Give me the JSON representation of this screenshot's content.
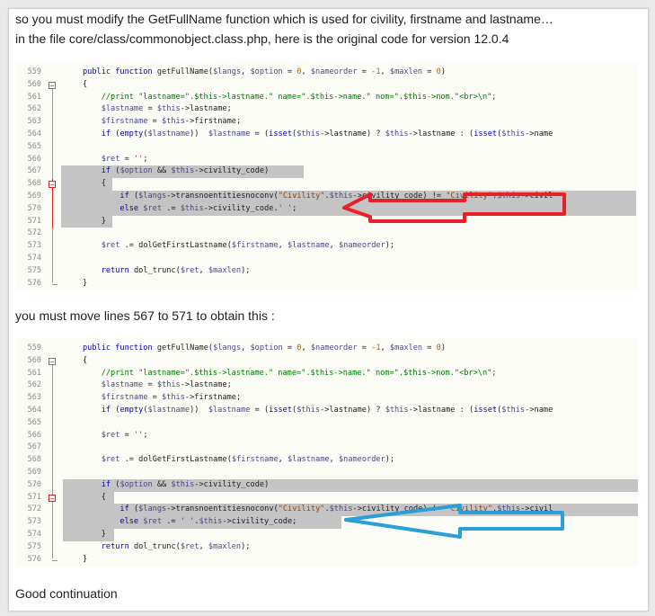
{
  "intro": {
    "line1": "so you must modify the GetFullName function which is used for civility, firstname and lastname…",
    "line2": "in the file core/class/commonobject.class.php, here is the original code for version 12.0.4"
  },
  "middle_text": "you must move lines 567 to 571 to obtain this :",
  "closing_text": "Good continuation",
  "colors": {
    "red_arrow": "#e8202a",
    "blue_arrow": "#2a9fd8",
    "selection": "#c4c4c4"
  },
  "code1": {
    "line_numbers": [
      "559",
      "560",
      "561",
      "562",
      "563",
      "564",
      "565",
      "566",
      "567",
      "568",
      "569",
      "570",
      "571",
      "572",
      "573",
      "574",
      "575",
      "576"
    ],
    "lines": [
      "public function getFullName($langs, $option = 0, $nameorder = -1, $maxlen = 0)",
      "{",
      "    //print \"lastname=\".$this->lastname.\" name=\".$this->name.\" nom=\".$this->nom.\"<br>\\n\";",
      "    $lastname = $this->lastname;",
      "    $firstname = $this->firstname;",
      "    if (empty($lastname))  $lastname = (isset($this->lastname) ? $this->lastname : (isset($this->name",
      "",
      "    $ret = '';",
      "    if ($option && $this->civility_code)",
      "    {",
      "        if ($langs->transnoentitiesnoconv(\"Civility\".$this->civility_code) != \"Civility\".$this->civil",
      "        else $ret .= $this->civility_code.' ';",
      "    }",
      "",
      "    $ret .= dolGetFirstLastname($firstname, $lastname, $nameorder);",
      "",
      "    return dol_trunc($ret, $maxlen);",
      "}"
    ]
  },
  "code2": {
    "line_numbers": [
      "559",
      "560",
      "561",
      "562",
      "563",
      "564",
      "565",
      "566",
      "567",
      "568",
      "569",
      "570",
      "571",
      "572",
      "573",
      "574",
      "575",
      "576"
    ],
    "lines": [
      "public function getFullName($langs, $option = 0, $nameorder = -1, $maxlen = 0)",
      "{",
      "    //print \"lastname=\".$this->lastname.\" name=\".$this->name.\" nom=\".$this->nom.\"<br>\\n\";",
      "    $lastname = $this->lastname;",
      "    $firstname = $this->firstname;",
      "    if (empty($lastname))  $lastname = (isset($this->lastname) ? $this->lastname : (isset($this->name",
      "",
      "    $ret = '';",
      "",
      "    $ret .= dolGetFirstLastname($firstname, $lastname, $nameorder);",
      "",
      "    if ($option && $this->civility_code)",
      "    {",
      "        if ($langs->transnoentitiesnoconv(\"Civility\".$this->civility_code) != \"Civility\".$this->civil",
      "        else $ret .= ' '.$this->civility_code;",
      "    }",
      "    return dol_trunc($ret, $maxlen);",
      "}"
    ]
  }
}
